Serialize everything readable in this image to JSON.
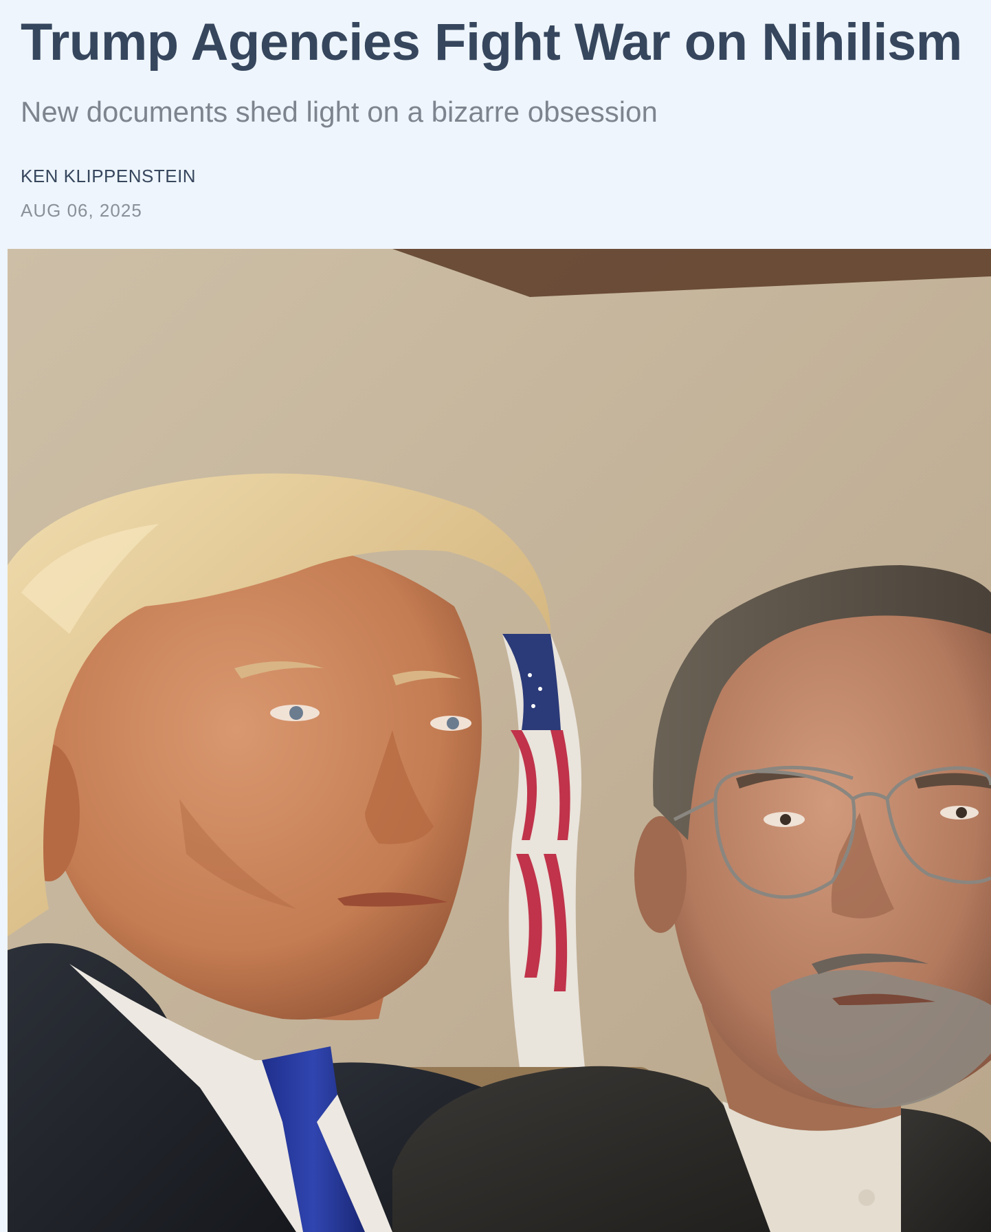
{
  "article": {
    "title": "Trump Agencies Fight War on Nihilism",
    "subtitle": "New documents shed light on a bizarre obsession",
    "author": "KEN KLIPPENSTEIN",
    "date": "AUG 06, 2025"
  }
}
